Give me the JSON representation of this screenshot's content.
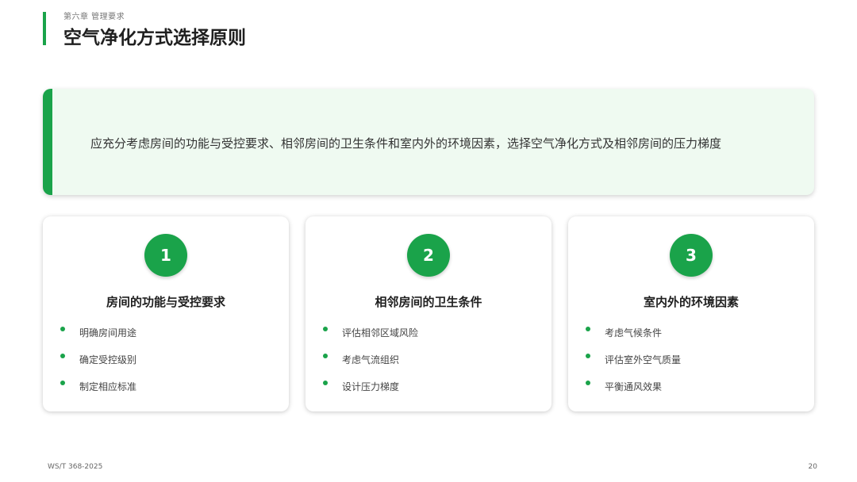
{
  "header": {
    "chapter": "第六章 管理要求",
    "title": "空气净化方式选择原则"
  },
  "principle": {
    "text": "应充分考虑房间的功能与受控要求、相邻房间的卫生条件和室内外的环境因素，选择空气净化方式及相邻房间的压力梯度"
  },
  "cards": [
    {
      "number": "1",
      "title": "房间的功能与受控要求",
      "items": [
        "明确房间用途",
        "确定受控级别",
        "制定相应标准"
      ]
    },
    {
      "number": "2",
      "title": "相邻房间的卫生条件",
      "items": [
        "评估相邻区域风险",
        "考虑气流组织",
        "设计压力梯度"
      ]
    },
    {
      "number": "3",
      "title": "室内外的环境因素",
      "items": [
        "考虑气候条件",
        "评估室外空气质量",
        "平衡通风效果"
      ]
    }
  ],
  "footer": {
    "standard": "WS/T 368-2025",
    "page": "20"
  },
  "colors": {
    "accent": "#1aa34a",
    "principle_bg": "#effaf1"
  }
}
